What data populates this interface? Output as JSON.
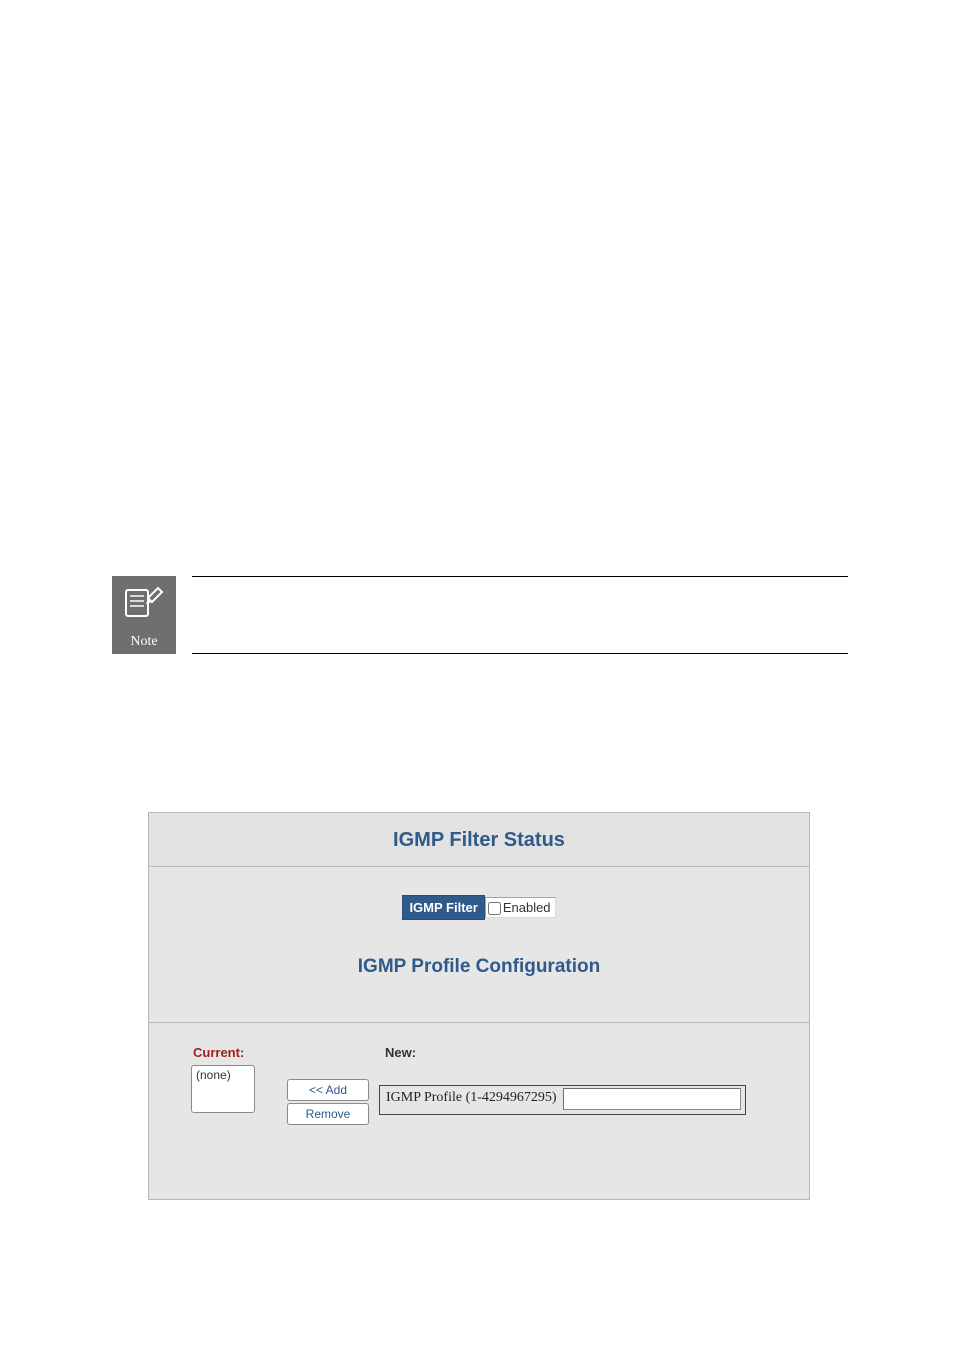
{
  "note": {
    "icon_label": "Note"
  },
  "panel": {
    "title": "IGMP Filter Status",
    "filter_label": "IGMP Filter",
    "filter_checkbox_text": "Enabled",
    "sub_title": "IGMP Profile Configuration",
    "current_label": "Current:",
    "new_label": "New:",
    "listbox_placeholder": "(none)",
    "add_button": "<< Add",
    "remove_button": "Remove",
    "profile_input_label": "IGMP Profile (1-4294967295)"
  }
}
